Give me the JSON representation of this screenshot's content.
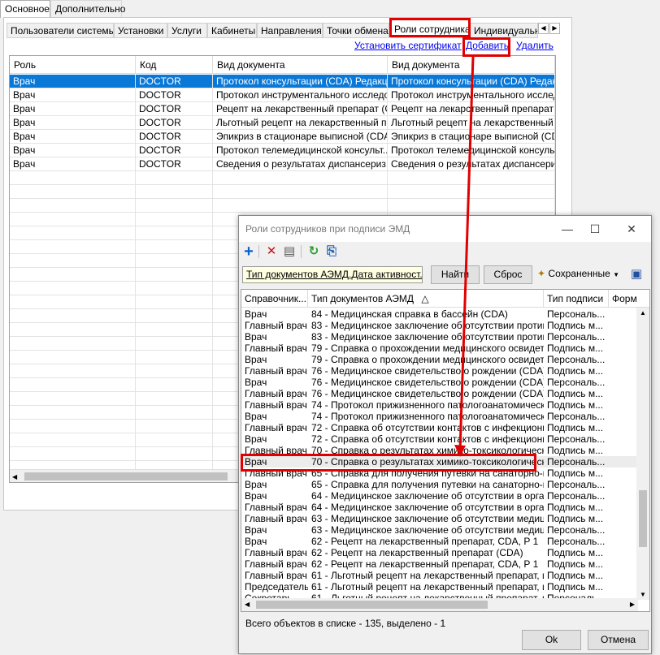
{
  "main": {
    "top_tabs": [
      "Основное",
      "Дополнительно"
    ],
    "sub_tabs": [
      "Пользователи системы",
      "Установки",
      "Услуги",
      "Кабинеты",
      "Направления",
      "Точки обмена",
      "Роли сотрудника",
      "Индивидуальные"
    ],
    "nav_left": "◀",
    "nav_right": "▶",
    "links": {
      "set_certificate": "Установить сертификат",
      "add": "Добавить",
      "delete": "Удалить"
    },
    "grid": {
      "columns": [
        "Роль",
        "Код",
        "Вид документа",
        "Вид документа"
      ],
      "rows": [
        [
          "Врач",
          "DOCTOR",
          "Протокол консультации (CDA) Редакц...",
          "Протокол консультации (CDA) Редакц..."
        ],
        [
          "Врач",
          "DOCTOR",
          "Протокол инструментального исследо...",
          "Протокол инструментального исследо..."
        ],
        [
          "Врач",
          "DOCTOR",
          "Рецепт на лекарственный препарат (С...",
          "Рецепт на лекарственный препарат (С..."
        ],
        [
          "Врач",
          "DOCTOR",
          "Льготный рецепт на лекарственный п...",
          "Льготный рецепт на лекарственный п..."
        ],
        [
          "Врач",
          "DOCTOR",
          "Эпикриз в стационаре выписной (CDA)",
          "Эпикриз в стационаре выписной (CDA)"
        ],
        [
          "Врач",
          "DOCTOR",
          "Протокол телемедицинской консульт...",
          "Протокол телемедицинской консульт..."
        ],
        [
          "Врач",
          "DOCTOR",
          "Сведения о результатах диспансериз...",
          "Сведения о результатах диспансериз..."
        ]
      ],
      "selected_row": 0
    }
  },
  "dialog": {
    "title": "Роли сотрудников при подписи ЭМД",
    "controls": {
      "minimize": "—",
      "maximize": "☐",
      "close": "✕"
    },
    "toolbar_icons": [
      "add-icon",
      "delete-icon",
      "properties-icon",
      "refresh-icon",
      "export-icon"
    ],
    "filter_text": "Тип документов АЭМД.Дата активност...",
    "find_label": "Найти",
    "reset_label": "Сброс",
    "saved_label": "Сохраненные",
    "columns": [
      "Справочник...",
      "Тип документов АЭМД",
      "Тип подписи",
      "Форм"
    ],
    "sort_indicator": "△",
    "rows": [
      [
        "Врач",
        "84 - Медицинская справка в бассейн (CDA)",
        "Персональ..."
      ],
      [
        "Главный врач",
        "83 - Медицинское заключение об отсутствии против...",
        "Подпись м..."
      ],
      [
        "Врач",
        "83 - Медицинское заключение об отсутствии против...",
        "Персональ..."
      ],
      [
        "Главный врач",
        "79 - Справка о прохождении медицинского освидете...",
        "Подпись м..."
      ],
      [
        "Врач",
        "79 - Справка о прохождении медицинского освидете...",
        "Персональ..."
      ],
      [
        "Главный врач",
        "76 - Медицинское свидетельство о рождении (CDA)",
        "Подпись м..."
      ],
      [
        "Врач",
        "76 - Медицинское свидетельство о рождении (CDA)",
        "Персональ..."
      ],
      [
        "Главный врач",
        "76 - Медицинское свидетельство о рождении (CDA)",
        "Подпись м..."
      ],
      [
        "Главный врач",
        "74 - Протокол прижизненного патологоанатомическ...",
        "Подпись м..."
      ],
      [
        "Врач",
        "74 - Протокол прижизненного патологоанатомическ...",
        "Персональ..."
      ],
      [
        "Главный врач",
        "72 - Справка об отсутствии контактов с инфекционн...",
        "Подпись м..."
      ],
      [
        "Врач",
        "72 - Справка об отсутствии контактов с инфекционн...",
        "Персональ..."
      ],
      [
        "Главный врач",
        "70 - Справка о результатах химико-токсикологическ...",
        "Подпись м..."
      ],
      [
        "Врач",
        "70 - Справка о результатах химико-токсикологическ...",
        "Персональ..."
      ],
      [
        "Главный врач",
        "65 - Справка для получения путевки на санаторно-ку...",
        "Подпись м..."
      ],
      [
        "Врач",
        "65 - Справка для получения путевки на санаторно-ку...",
        "Персональ..."
      ],
      [
        "Врач",
        "64 - Медицинское заключение об отсутствии в орган...",
        "Персональ..."
      ],
      [
        "Главный врач",
        "64 - Медицинское заключение об отсутствии в орган...",
        "Подпись м..."
      ],
      [
        "Главный врач",
        "63 - Медицинское заключение об отсутствии медици...",
        "Подпись м..."
      ],
      [
        "Врач",
        "63 - Медицинское заключение об отсутствии медици...",
        "Персональ..."
      ],
      [
        "Врач",
        "62 - Рецепт на лекарственный препарат, CDA, Р 1",
        "Персональ..."
      ],
      [
        "Главный врач",
        "62 - Рецепт на лекарственный препарат (CDA)",
        "Подпись м..."
      ],
      [
        "Главный врач",
        "62 - Рецепт на лекарственный препарат, CDA, Р 1",
        "Подпись м..."
      ],
      [
        "Главный врач",
        "61 - Льготный рецепт на лекарственный препарат, и...",
        "Подпись м..."
      ],
      [
        "Председатель",
        "61 - Льготный рецепт на лекарственный препарат, и...",
        "Подпись м..."
      ],
      [
        "Секретарь",
        "61 - Льготный рецепт на лекарственный препарат, и...",
        "Персональ..."
      ]
    ],
    "highlighted_row": 13,
    "status": "Всего объектов в списке - 135, выделено - 1",
    "ok_label": "Ok",
    "cancel_label": "Отмена"
  },
  "colors": {
    "selection": "#0a78d7",
    "annotation": "#e00000",
    "link": "#0000ee",
    "filter_background": "#ffffe1"
  }
}
